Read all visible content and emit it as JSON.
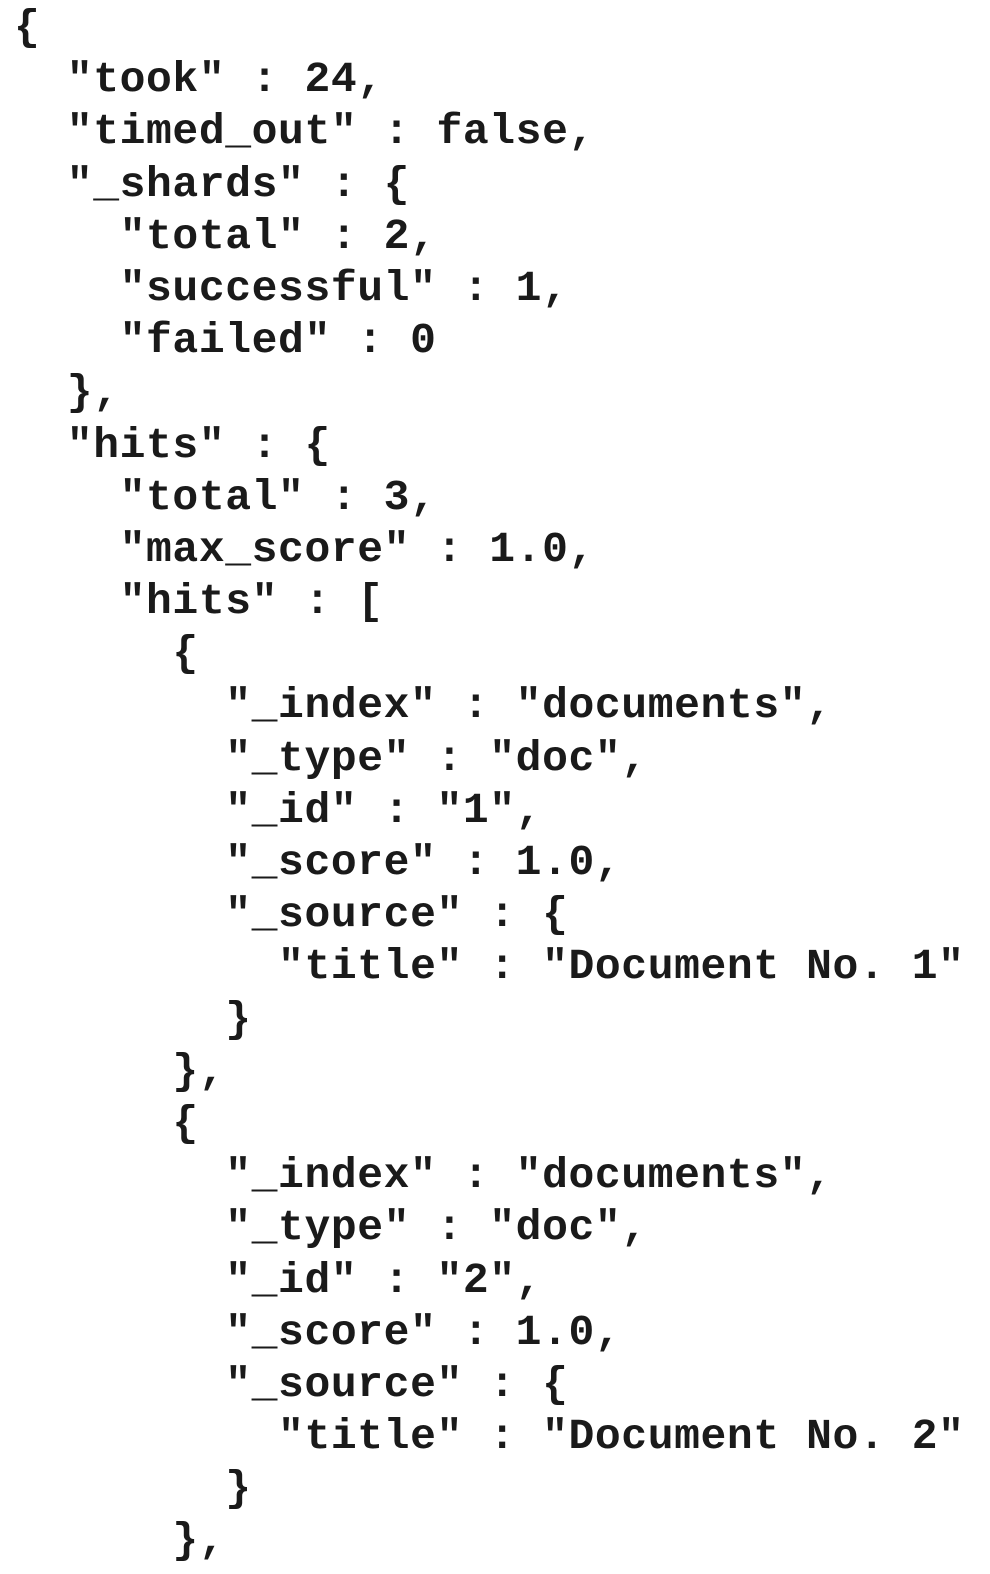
{
  "code": {
    "lines": [
      "{",
      "  \"took\" : 24,",
      "  \"timed_out\" : false,",
      "  \"_shards\" : {",
      "    \"total\" : 2,",
      "    \"successful\" : 1,",
      "    \"failed\" : 0",
      "  },",
      "  \"hits\" : {",
      "    \"total\" : 3,",
      "    \"max_score\" : 1.0,",
      "    \"hits\" : [",
      "      {",
      "        \"_index\" : \"documents\",",
      "        \"_type\" : \"doc\",",
      "        \"_id\" : \"1\",",
      "        \"_score\" : 1.0,",
      "        \"_source\" : {",
      "          \"title\" : \"Document No. 1\"",
      "        }",
      "      },",
      "      {",
      "        \"_index\" : \"documents\",",
      "        \"_type\" : \"doc\",",
      "        \"_id\" : \"2\",",
      "        \"_score\" : 1.0,",
      "        \"_source\" : {",
      "          \"title\" : \"Document No. 2\"",
      "        }",
      "      },"
    ]
  }
}
